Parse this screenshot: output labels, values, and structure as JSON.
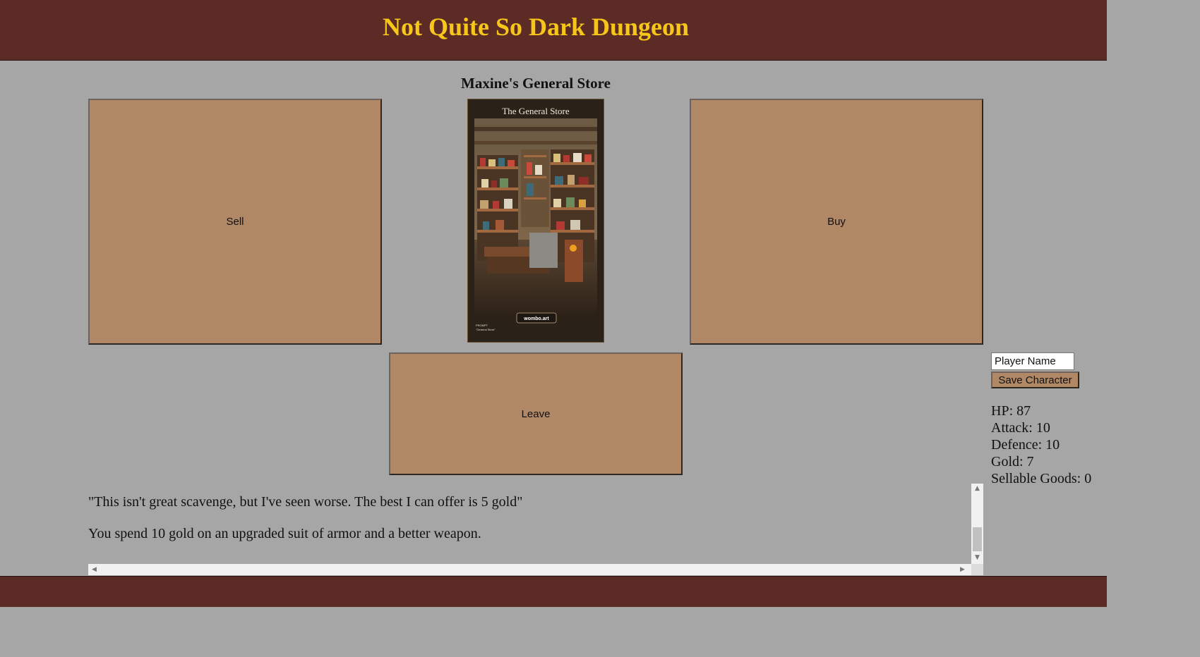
{
  "header": {
    "title": "Not Quite So Dark Dungeon"
  },
  "location": {
    "title": "Maxine's General Store"
  },
  "actions": {
    "sell": "Sell",
    "buy": "Buy",
    "leave": "Leave"
  },
  "store_image": {
    "caption": "The General Store",
    "badge": "wombo.art",
    "prompt_label": "PROMPT",
    "prompt_text": "\"General Store\""
  },
  "player": {
    "name_value": "Player Name",
    "save_label": "Save Character"
  },
  "stats": {
    "hp": "HP: 87",
    "attack": "Attack: 10",
    "defence": "Defence: 10",
    "gold": "Gold: 7",
    "goods": "Sellable Goods: 0"
  },
  "log": {
    "entries": [
      "\"This isn't great scavenge, but I've seen worse. The best I can offer is 5 gold\"",
      "You spend 10 gold on an upgraded suit of armor and a better weapon."
    ]
  },
  "colors": {
    "header_bg": "#5c2b25",
    "title": "#f6c71a",
    "page_bg": "#a6a6a6",
    "button_bg": "#b08865"
  }
}
